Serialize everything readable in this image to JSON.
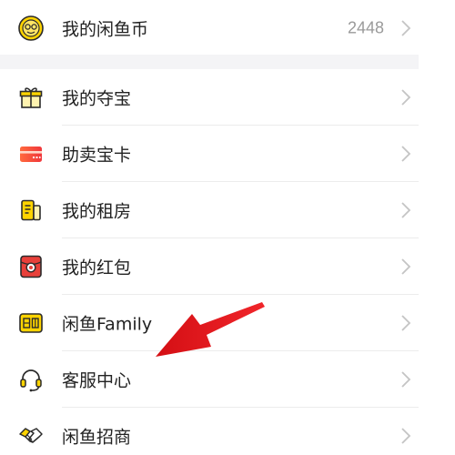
{
  "coin_row": {
    "label": "我的闲鱼币",
    "value": "2448",
    "icon": "coin-face-icon"
  },
  "menu_items": [
    {
      "label": "我的夺宝",
      "icon": "gift-box-icon"
    },
    {
      "label": "助卖宝卡",
      "icon": "red-card-icon"
    },
    {
      "label": "我的租房",
      "icon": "rental-doc-icon"
    },
    {
      "label": "我的红包",
      "icon": "red-envelope-icon"
    },
    {
      "label": "闲鱼Family",
      "icon": "family-badge-icon"
    },
    {
      "label": "客服中心",
      "icon": "headset-icon"
    },
    {
      "label": "闲鱼招商",
      "icon": "handshake-icon"
    }
  ],
  "colors": {
    "text": "#222222",
    "muted": "#9a9a9a",
    "brand_yellow": "#ffd400",
    "accent_red": "#e8212a",
    "separator": "#f4f4f6"
  }
}
